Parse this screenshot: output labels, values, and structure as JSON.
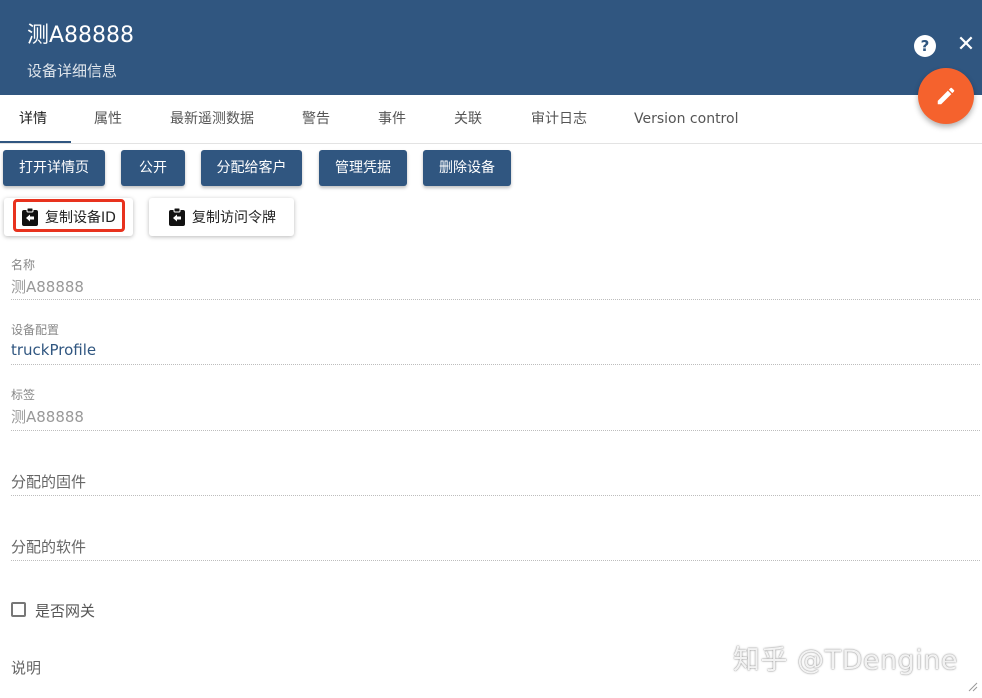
{
  "header": {
    "title": "测A88888",
    "subtitle": "设备详细信息",
    "help_label": "?",
    "close_label": "✕",
    "color": "#305680",
    "fab_color": "#f5622d"
  },
  "tabs": [
    {
      "label": "详情",
      "active": true
    },
    {
      "label": "属性"
    },
    {
      "label": "最新遥测数据"
    },
    {
      "label": "警告"
    },
    {
      "label": "事件"
    },
    {
      "label": "关联"
    },
    {
      "label": "审计日志"
    },
    {
      "label": "Version control"
    }
  ],
  "actions": {
    "open_details": "打开详情页",
    "make_public": "公开",
    "assign_customer": "分配给客户",
    "manage_credentials": "管理凭据",
    "delete_device": "删除设备",
    "copy_device_id": "复制设备ID",
    "copy_access_token": "复制访问令牌"
  },
  "fields": {
    "name_label": "名称",
    "name_value": "测A88888",
    "profile_label": "设备配置",
    "profile_value": "truckProfile",
    "label_label": "标签",
    "label_value": "测A88888",
    "firmware_placeholder": "分配的固件",
    "software_placeholder": "分配的软件",
    "gateway_label": "是否网关",
    "description_placeholder": "说明"
  },
  "watermark": "知乎 @TDengine",
  "icons": {
    "fab": "pencil-icon",
    "copy": "clipboard-arrow-icon",
    "help": "help-icon",
    "close": "close-icon"
  }
}
